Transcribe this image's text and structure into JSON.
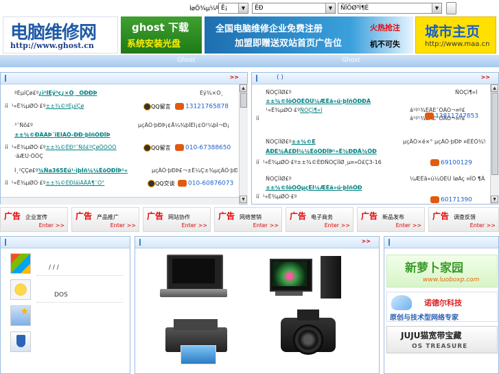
{
  "topbar": {
    "label": "ÍøÕ¾µ¼º½£º",
    "select1": "Ê¡",
    "select2": "ÊÐ",
    "select3": "ÑÏÖØ³Ì¶È"
  },
  "banners": {
    "logo_text": "电脑维修网",
    "logo_url": "http://www.ghost.cn",
    "ghost_line1": "ghost 下载",
    "ghost_line2": "系统安装光盘",
    "promo_line1": "全国电脑维修企业免费注册",
    "promo_line2": "加盟即赠送双站首页广告位",
    "promo_hot1": "火热抢注",
    "promo_hot2": "机不可失",
    "city_title": "城市主页",
    "city_url": "http://www.maa.cn"
  },
  "nav": {
    "left": "Ghost",
    "right": "Ghost"
  },
  "left_panel": {
    "more": ">>",
    "items": [
      {
        "line1_prefix": "ºÈµíÇø£º",
        "line1_link": "¿ì²ÍÊý³ç¿×Ô¸_ÓÐÐÞ",
        "line1_right": "Éý¾×Ö¸",
        "line2_prefix": "¹«Ë¾µØÖ·£º",
        "line2_link": "±±¾©ºÈµíÇø",
        "qq": "QQ留言",
        "tel": "13121765878"
      },
      {
        "line1_prefix": "³¯Ñô£º",
        "line1_link": "±±¾©ÐÂÂÞ´ïÉÌÂÖ-ÐÐ·þÎñÓÐÏÞ",
        "line1_right": "µçÄÔ·þÐÞ¡¢Å¼¾þÎÊÌ¡¢Ó²¼þÎ¬Ð¡",
        "line2_prefix": "¹«Ë¾µØÖ·£º",
        "line2_link": "±±¾©ÊÐ³¯Ñô£ºÇøÕÒÓÒ",
        "qq": "QQ留言",
        "tel": "010-67388650",
        "line3": "·äÆÚ·ÕÔÇ"
      },
      {
        "line1_prefix": "Ì¸²ÇÇø£º",
        "line1_link": "¾Ña365Éú¹·ìþÎñ¼¼ÊõÓÐÏÞ¹«",
        "line1_right": "µçÄÔ·þÐÞ£¬±Ê¼Ç±¾µçÄÔ·þÐÞ£¬",
        "line2_prefix": "¹«Ë¾µØÖ·£º",
        "line2_link": "±±¾©ÊÐÌáìÃÅÃ¶¯Ô°",
        "qq": "QQ交谈",
        "tel": "010-60876073"
      }
    ]
  },
  "right_panel": {
    "title": "(   )",
    "more": ">>",
    "items": [
      {
        "line1_prefix": "ÑÓÇìÏØ£º",
        "line1_right": "ÑÓÇì¶«Í",
        "line2_link": "±±¾©ÍòÓÖÊÔÛ¼ÆËã»ú·þÎñÖÐÐÄ",
        "line2_right": "ÑÓÇì¶«Í",
        "line3_prefix": "¹«Ë¾µØÖ·£º",
        "line3_link": "ÑÓÇì¶«Í",
        "line3_right": "á¹º¹¾ÊÂÉ¯ÔÂÒ¬¤º£",
        "line4": "á¹º¹¾ÊÂÉ¯ÔÂÒ¬¤º£",
        "tel": "13811747853"
      },
      {
        "line1_prefix": "ÑÓÇìÏØ£º",
        "line1_link": "±±¾©É­",
        "line1_right": "µçÄÔ×é×° µçÄÔ·þÐÞ ¤ÉÊÕ¾Ý¹Ä",
        "line2_link": "ÁÐÉ¾Ä£ÐÍ¼¼ÊõÓÐÏÞ¹«Ë¾ÐÐÃ¾ÔÐ",
        "line3_prefix": "¹«Ë¾µØÖ·£º",
        "line3_link": "±±¾©ÊÐÑÓÇìÏØ¸µ¤»Ô£Ç3-16",
        "tel": "69100129"
      },
      {
        "line1_prefix": "ÑÓÇìÏØ£º",
        "line1_right": "¼ÆËã»ú¼ÓÊÛ ÍøÂç ¤ÏÔ ¶Ã",
        "line2_link": "±±¾©ÍòÓÖµçÊÍ¼ÆËã»ú·þÎñÖÐ",
        "line3_prefix": "¹«Ë¾µØÖ·£º",
        "tel": "60171390"
      }
    ]
  },
  "ad_bar": [
    {
      "ad": "广告",
      "cat": "企业宣传",
      "enter": "Enter >>"
    },
    {
      "ad": "广告",
      "cat": "产品推广",
      "enter": "Enter >>"
    },
    {
      "ad": "广告",
      "cat": "网站协作",
      "enter": "Enter >>"
    },
    {
      "ad": "广告",
      "cat": "网络营销",
      "enter": "Enter >>"
    },
    {
      "ad": "广告",
      "cat": "电子商务",
      "enter": "Enter >>"
    },
    {
      "ad": "广告",
      "cat": "新品发布",
      "enter": "Enter >>"
    },
    {
      "ad": "广告",
      "cat": "调查反馈",
      "enter": "Enter >>"
    }
  ],
  "bottom_left": {
    "line1": "/ / /",
    "line2": "DOS"
  },
  "bottom_mid": {
    "more": ">>"
  },
  "sponsors": {
    "s1_text": "新萝卜家园",
    "s1_url": "www.luoboxp.com",
    "s2_title": "诺德尔科技",
    "s2_sub": "原创与技术型网络专家",
    "s3_title": "JUJU猫宽带宝藏",
    "s3_sub": "OS TREASURE"
  },
  "colors": {
    "accent": "#3f7fc6",
    "ad_red": "#e60000",
    "link": "#008080",
    "tel": "#1a5fcc"
  }
}
